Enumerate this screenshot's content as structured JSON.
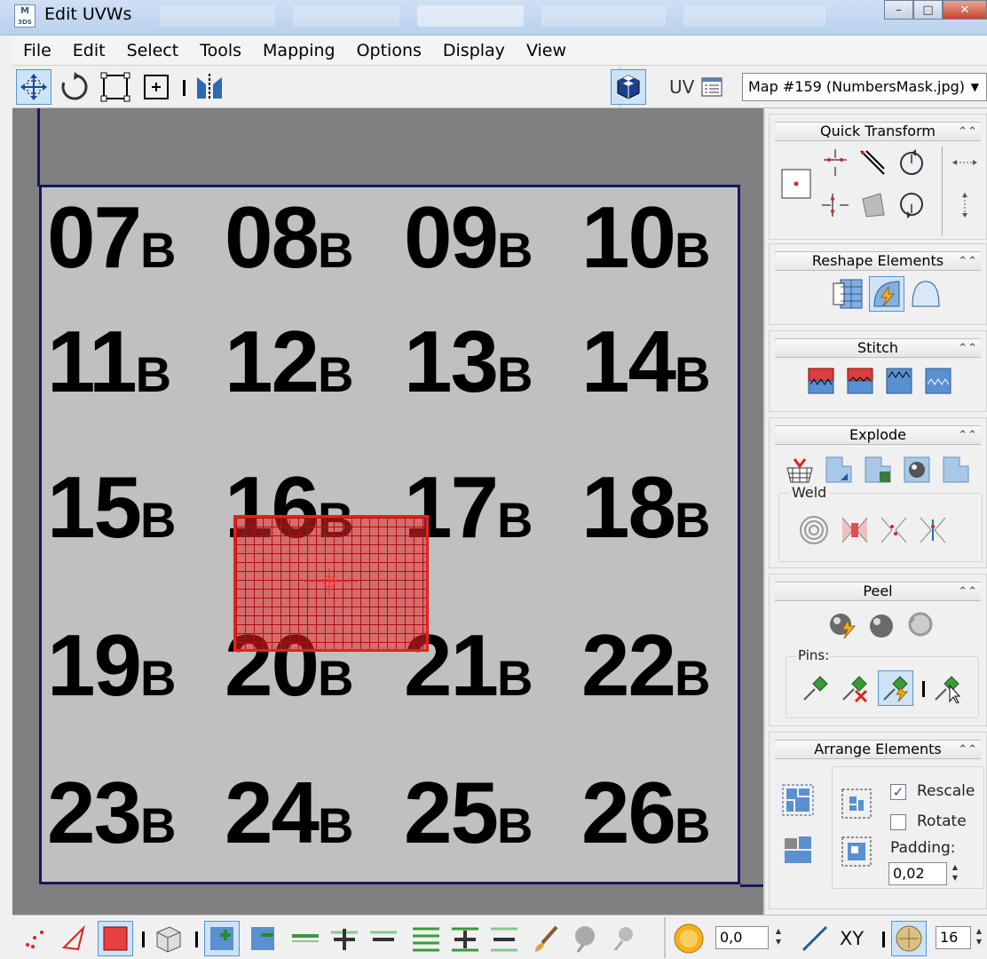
{
  "window": {
    "title": "Edit UVWs",
    "app_badge_top": "M",
    "app_badge_bottom": "3DS",
    "minimize": "–",
    "maximize": "□",
    "close": "✕"
  },
  "menu": [
    "File",
    "Edit",
    "Select",
    "Tools",
    "Mapping",
    "Options",
    "Display",
    "View"
  ],
  "toolbar": {
    "uv_label": "UV",
    "map_selected": "Map #159 (NumbersMask.jpg)",
    "active_tool": "freeform-mode"
  },
  "viewport": {
    "grid_labels": [
      [
        "07",
        "08",
        "09",
        "10"
      ],
      [
        "11",
        "12",
        "13",
        "14"
      ],
      [
        "15",
        "16",
        "17",
        "18"
      ],
      [
        "19",
        "20",
        "21",
        "22"
      ],
      [
        "23",
        "24",
        "25",
        "26"
      ]
    ],
    "label_suffix": "B",
    "selected_label": "16",
    "colors": {
      "background": "#808080",
      "texture": "#c0c0c0",
      "border": "#15185c",
      "selection": "#e62020"
    }
  },
  "panels": {
    "quick_transform": {
      "title": "Quick Transform"
    },
    "reshape_elements": {
      "title": "Reshape Elements"
    },
    "stitch": {
      "title": "Stitch"
    },
    "explode": {
      "title": "Explode",
      "weld_label": "Weld"
    },
    "peel": {
      "title": "Peel",
      "pins_label": "Pins:"
    },
    "arrange_elements": {
      "title": "Arrange Elements",
      "rescale_label": "Rescale",
      "rescale_checked": true,
      "rotate_label": "Rotate",
      "rotate_checked": false,
      "padding_label": "Padding:",
      "padding_value": "0,02"
    }
  },
  "bottom_toolbar": {
    "soft_select_value": "0,0",
    "xy_label": "XY",
    "grid_value": "16"
  }
}
